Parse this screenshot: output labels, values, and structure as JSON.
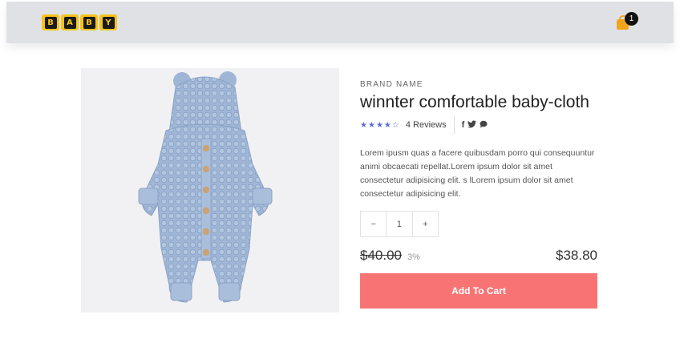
{
  "header": {
    "logo_letters": [
      "B",
      "A",
      "B",
      "Y"
    ],
    "cart_count": "1"
  },
  "product": {
    "brand": "BRAND NAME",
    "title": "winnter comfortable baby-cloth",
    "rating_stars": 4,
    "reviews": "4 Reviews",
    "social_icons": [
      "facebook-icon",
      "twitter-icon",
      "chat-icon"
    ],
    "description": "Lorem ipusm quas a facere quibusdam porro qui consequuntur animi obcaecati repellat.Lorem ipsum dolor sit amet consectetur adipisicing elit. s lLorem ipsum dolor sit amet consectetur adipisicing elit.",
    "quantity": {
      "minus": "−",
      "value": "1",
      "plus": "+"
    },
    "old_price": "$40.00",
    "discount": "3%",
    "new_price": "$38.80",
    "add_to_cart": "Add To Cart"
  },
  "colors": {
    "header_bg": "#dfe1e5",
    "logo_yellow": "#f7c21a",
    "cart_orange": "#f2a51a",
    "star_color": "#5b6fd6",
    "button_bg": "#f87474",
    "garment": "#9fb6d6"
  }
}
